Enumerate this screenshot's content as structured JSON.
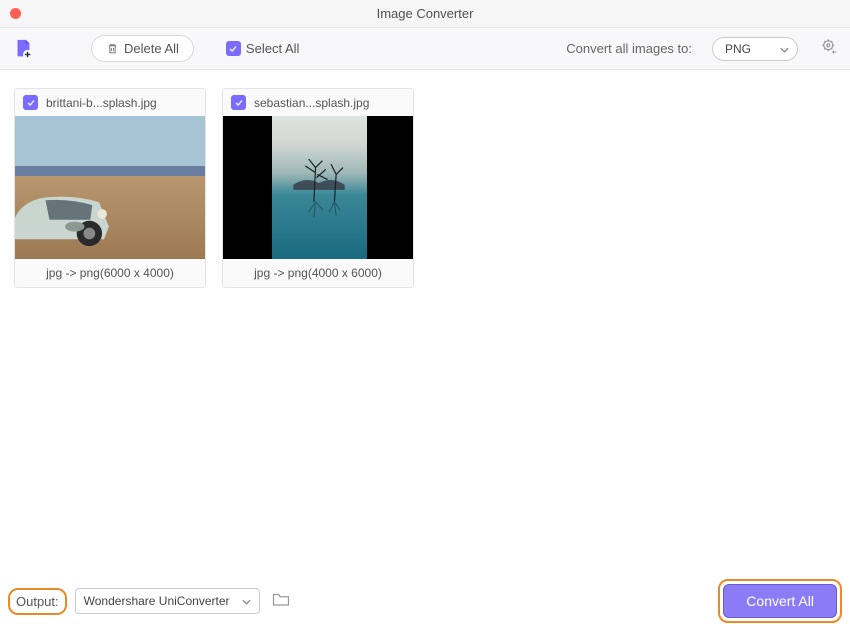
{
  "window": {
    "title": "Image Converter"
  },
  "toolbar": {
    "delete_all_label": "Delete All",
    "select_all_label": "Select All",
    "convert_to_label": "Convert all images to:",
    "format_selected": "PNG"
  },
  "images": [
    {
      "filename": "brittani-b...splash.jpg",
      "conversion": "jpg -> png(6000 x 4000)",
      "selected": true
    },
    {
      "filename": "sebastian...splash.jpg",
      "conversion": "jpg -> png(4000 x 6000)",
      "selected": true
    }
  ],
  "bottom": {
    "output_label": "Output:",
    "output_path": "Wondershare UniConverter",
    "convert_all_label": "Convert All"
  }
}
